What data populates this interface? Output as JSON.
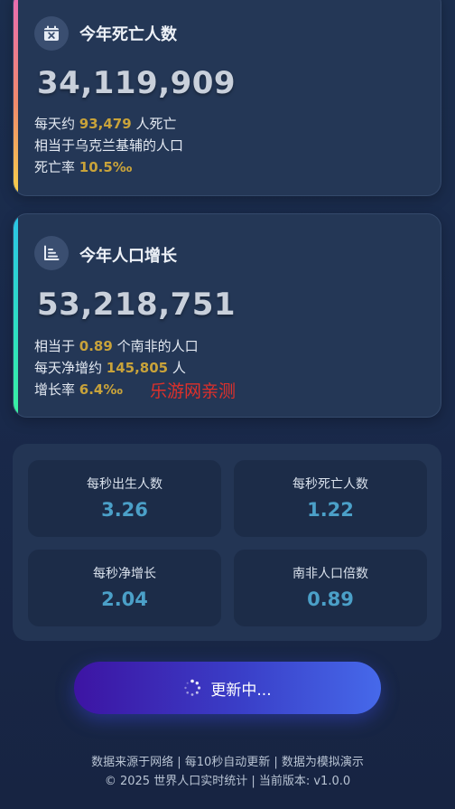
{
  "deaths_card": {
    "title": "今年死亡人数",
    "number": "34,119,909",
    "line1_prefix": "每天约",
    "line1_value": "93,479",
    "line1_suffix": "人死亡",
    "line2": "相当于乌克兰基辅的人口",
    "line3_prefix": "死亡率",
    "line3_value": "10.5‰",
    "icon": "calendar-x-icon",
    "accent_colors": [
      "#e86bb6",
      "#f08a6c",
      "#f6d04a"
    ]
  },
  "growth_card": {
    "title": "今年人口增长",
    "number": "53,218,751",
    "line1_prefix": "相当于",
    "line1_value": "0.89",
    "line1_suffix": "个南非的人口",
    "line2_prefix": "每天净增约",
    "line2_value": "145,805",
    "line2_suffix": "人",
    "line3_prefix": "增长率",
    "line3_value": "6.4‰",
    "icon": "bar-chart-icon",
    "accent_colors": [
      "#2bc4e6",
      "#2ee0c0",
      "#3af0a0"
    ]
  },
  "watermark": "乐游网亲测",
  "stats": [
    {
      "label": "每秒出生人数",
      "value": "3.26"
    },
    {
      "label": "每秒死亡人数",
      "value": "1.22"
    },
    {
      "label": "每秒净增长",
      "value": "2.04"
    },
    {
      "label": "南非人口倍数",
      "value": "0.89"
    }
  ],
  "update_button": {
    "label": "更新中...",
    "icon": "spinner-icon"
  },
  "footer": {
    "line1": "数据来源于网络 | 每10秒自动更新 | 数据为模拟演示",
    "line2": "© 2025 世界人口实时统计 | 当前版本: v1.0.0"
  },
  "colors": {
    "highlight": "#c9a33a",
    "stat_value": "#4ba0c8",
    "watermark": "#e0302a"
  }
}
